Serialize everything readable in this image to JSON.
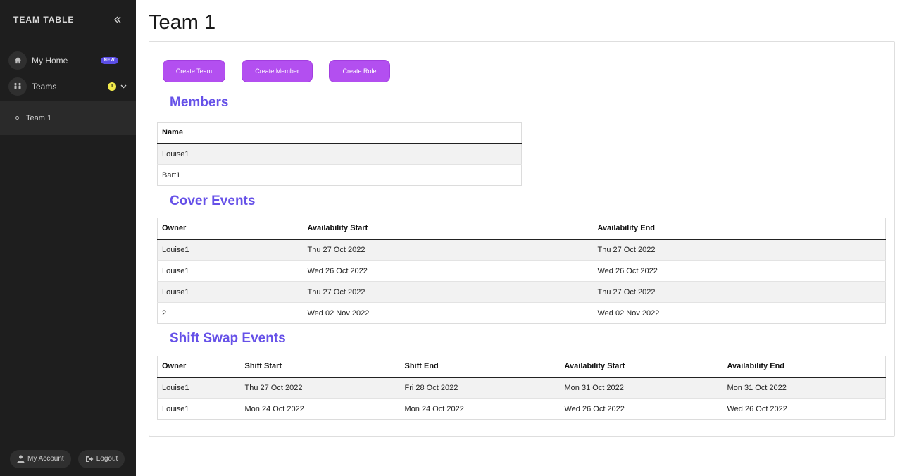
{
  "sidebar": {
    "brand": "TEAM TABLE",
    "items": [
      {
        "label": "My Home",
        "icon": "home-icon",
        "badge": "NEW"
      },
      {
        "label": "Teams",
        "icon": "users-icon",
        "badge": "1"
      }
    ],
    "subitems": [
      {
        "label": "Team 1"
      }
    ],
    "footer": {
      "account_label": "My Account",
      "logout_label": "Logout"
    }
  },
  "main": {
    "title": "Team 1",
    "buttons": {
      "create_team": "Create Team",
      "create_member": "Create Member",
      "create_role": "Create Role"
    },
    "members": {
      "title": "Members",
      "columns": [
        "Name"
      ],
      "rows": [
        [
          "Louise1"
        ],
        [
          "Bart1"
        ]
      ]
    },
    "cover_events": {
      "title": "Cover Events",
      "columns": [
        "Owner",
        "Availability Start",
        "Availability End"
      ],
      "rows": [
        [
          "Louise1",
          "Thu 27 Oct 2022",
          "Thu 27 Oct 2022"
        ],
        [
          "Louise1",
          "Wed 26 Oct 2022",
          "Wed 26 Oct 2022"
        ],
        [
          "Louise1",
          "Thu 27 Oct 2022",
          "Thu 27 Oct 2022"
        ],
        [
          "2",
          "Wed 02 Nov 2022",
          "Wed 02 Nov 2022"
        ]
      ]
    },
    "shift_swap_events": {
      "title": "Shift Swap Events",
      "columns": [
        "Owner",
        "Shift Start",
        "Shift End",
        "Availability Start",
        "Availability End"
      ],
      "rows": [
        [
          "Louise1",
          "Thu 27 Oct 2022",
          "Fri 28 Oct 2022",
          "Mon 31 Oct 2022",
          "Mon 31 Oct 2022"
        ],
        [
          "Louise1",
          "Mon 24 Oct 2022",
          "Mon 24 Oct 2022",
          "Wed 26 Oct 2022",
          "Wed 26 Oct 2022"
        ]
      ]
    }
  },
  "colors": {
    "accent": "#b34ff0",
    "heading": "#6651e8",
    "sidebar_bg": "#1e1e1e",
    "badge_new": "#5b4ee6",
    "badge_count": "#f0e94b"
  }
}
